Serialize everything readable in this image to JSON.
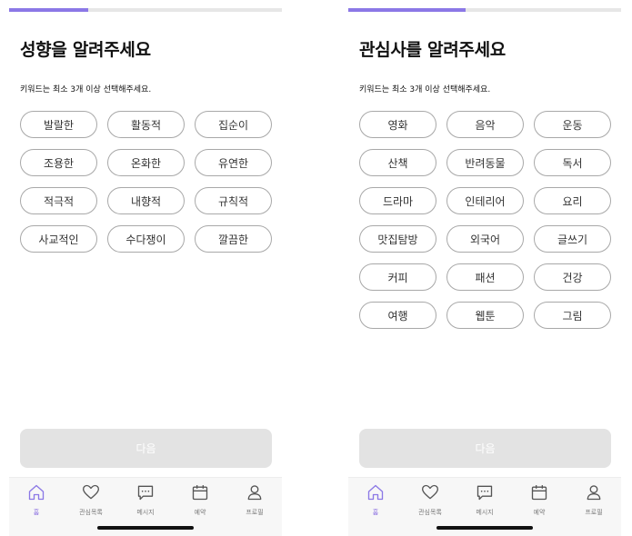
{
  "colors": {
    "accent": "#8b78e6",
    "chip_border": "#a8a8a8",
    "button_disabled": "#e3e3e3"
  },
  "screens": [
    {
      "progress": 0.29,
      "title": "성향을 알려주세요",
      "subtitle": "키워드는 최소 3개 이상 선택해주세요.",
      "chips": [
        "발랄한",
        "활동적",
        "집순이",
        "조용한",
        "온화한",
        "유연한",
        "적극적",
        "내향적",
        "규칙적",
        "사교적인",
        "수다쟁이",
        "깔끔한"
      ],
      "next_label": "다음"
    },
    {
      "progress": 0.43,
      "title": "관심사를 알려주세요",
      "subtitle": "키워드는 최소 3개 이상 선택해주세요.",
      "chips": [
        "영화",
        "음악",
        "운동",
        "산책",
        "반려동물",
        "독서",
        "드라마",
        "인테리어",
        "요리",
        "맛집탐방",
        "외국어",
        "글쓰기",
        "커피",
        "패션",
        "건강",
        "여행",
        "웹툰",
        "그림"
      ],
      "next_label": "다음"
    }
  ],
  "tabbar": [
    {
      "label": "홈",
      "icon": "home-icon",
      "active": true
    },
    {
      "label": "관심목록",
      "icon": "heart-icon",
      "active": false
    },
    {
      "label": "메시지",
      "icon": "chat-icon",
      "active": false
    },
    {
      "label": "예약",
      "icon": "calendar-icon",
      "active": false
    },
    {
      "label": "프로필",
      "icon": "profile-icon",
      "active": false
    }
  ]
}
